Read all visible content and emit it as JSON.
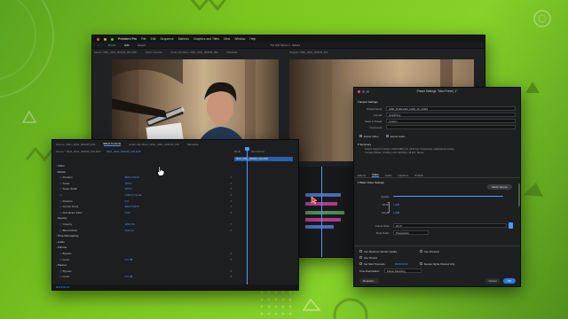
{
  "app": {
    "name": "Premiere Pro",
    "menu": [
      "File",
      "Edit",
      "Sequence",
      "Markers",
      "Graphics and Titles",
      "View",
      "Window",
      "Help"
    ],
    "workspaces": [
      "Import",
      "Edit",
      "Export"
    ],
    "doc_title": "The Still Sense 2 - Edited",
    "source_tabs": [
      "Source: 0001_0001_000245_001.MXF",
      "Effect Controls",
      "Audio Clip Mixer: 0001_0001_000245_001",
      "Metadata"
    ],
    "program_tab": "Program: 0001_0001_000245_001"
  },
  "effect_controls": {
    "tabs": [
      "Source: 0001_0001_000245_001",
      "Effect Controls",
      "Audio Clip Mixer: 0001_0001_000245_001",
      "Metadata"
    ],
    "clip": "Source * 0001_0001_000245_001.MXF",
    "clip2": "0001_0001_000245_001.MXF",
    "timecode_a": "00;00",
    "timecode_b": "00;13;02;12",
    "clip_bar": "0001_0001_000245_001.MXF",
    "sections": [
      "Video",
      "Motion",
      "Opacity",
      "Time Remapping",
      "Audio",
      "Volume",
      "Panner",
      "Volume"
    ],
    "props": [
      {
        "name": "Position",
        "value": "960.0   540.0"
      },
      {
        "name": "Scale",
        "value": "100.0"
      },
      {
        "name": "Scale Width",
        "value": "100.0"
      },
      {
        "name": "",
        "value": "Uniform Scale"
      },
      {
        "name": "Rotation",
        "value": "0.0"
      },
      {
        "name": "Anchor Point",
        "value": "960.0   540.0"
      },
      {
        "name": "Anti-flicker Filter",
        "value": "0.00"
      },
      {
        "name": "Opacity",
        "value": "100.0 %"
      },
      {
        "name": "Blend Mode",
        "value": "Normal"
      },
      {
        "name": "Bypass",
        "value": ""
      },
      {
        "name": "Level",
        "value": "0.0 dB"
      },
      {
        "name": "Bypass",
        "value": ""
      },
      {
        "name": "Level",
        "value": "0.0 dB"
      }
    ],
    "footer_time": "00;13;02;12"
  },
  "dialog": {
    "title": "Preset Settings: \"New Preset_1\"",
    "export_settings": "Export Settings",
    "labels": {
      "preset_name": "Preset Name:",
      "format": "Format:",
      "save_in": "Save in Preset:",
      "comments": "Comments:"
    },
    "values": {
      "preset_name": "1080_ProRes422_H264_2K_ACES",
      "format": "QuickTime",
      "save_in": "Custom",
      "comments": ""
    },
    "export_video": "Export Video",
    "export_audio": "Export Audio",
    "summary_title": "Summary",
    "summary_lines": [
      "Output: Saved on Assets: 1920x1080 (1.0), 29.97 fps, Progressive, Hardware Encoding",
      "Constant Bitrate, 10 Mbps, AAC 320 kbps, 48 kHz, Stereo"
    ],
    "tabs": [
      "Effects",
      "Video",
      "Audio",
      "Captions",
      "Publish"
    ],
    "basic_title": "Basic Video Settings",
    "match_source": "Match Source",
    "q_labels": [
      "Quality:",
      "Width:",
      "Height:",
      "Frame Rate:",
      "Field Order:",
      "Aspect:"
    ],
    "q_values": [
      "",
      "1,920",
      "1,080",
      "29.97",
      "Progressive",
      "Square Pixels (1.0)"
    ],
    "options": [
      "Use Maximum Render Quality",
      "Use Previews",
      "Use Proxies",
      "Set Start Timecode",
      "Render Alpha Channel Only",
      "Time Interpolation"
    ],
    "time_interp": "Frame Sampling",
    "start_tc": "00:00:00:00",
    "metadata_btn": "Metadata...",
    "cancel_btn": "Cancel",
    "ok_btn": "OK"
  }
}
